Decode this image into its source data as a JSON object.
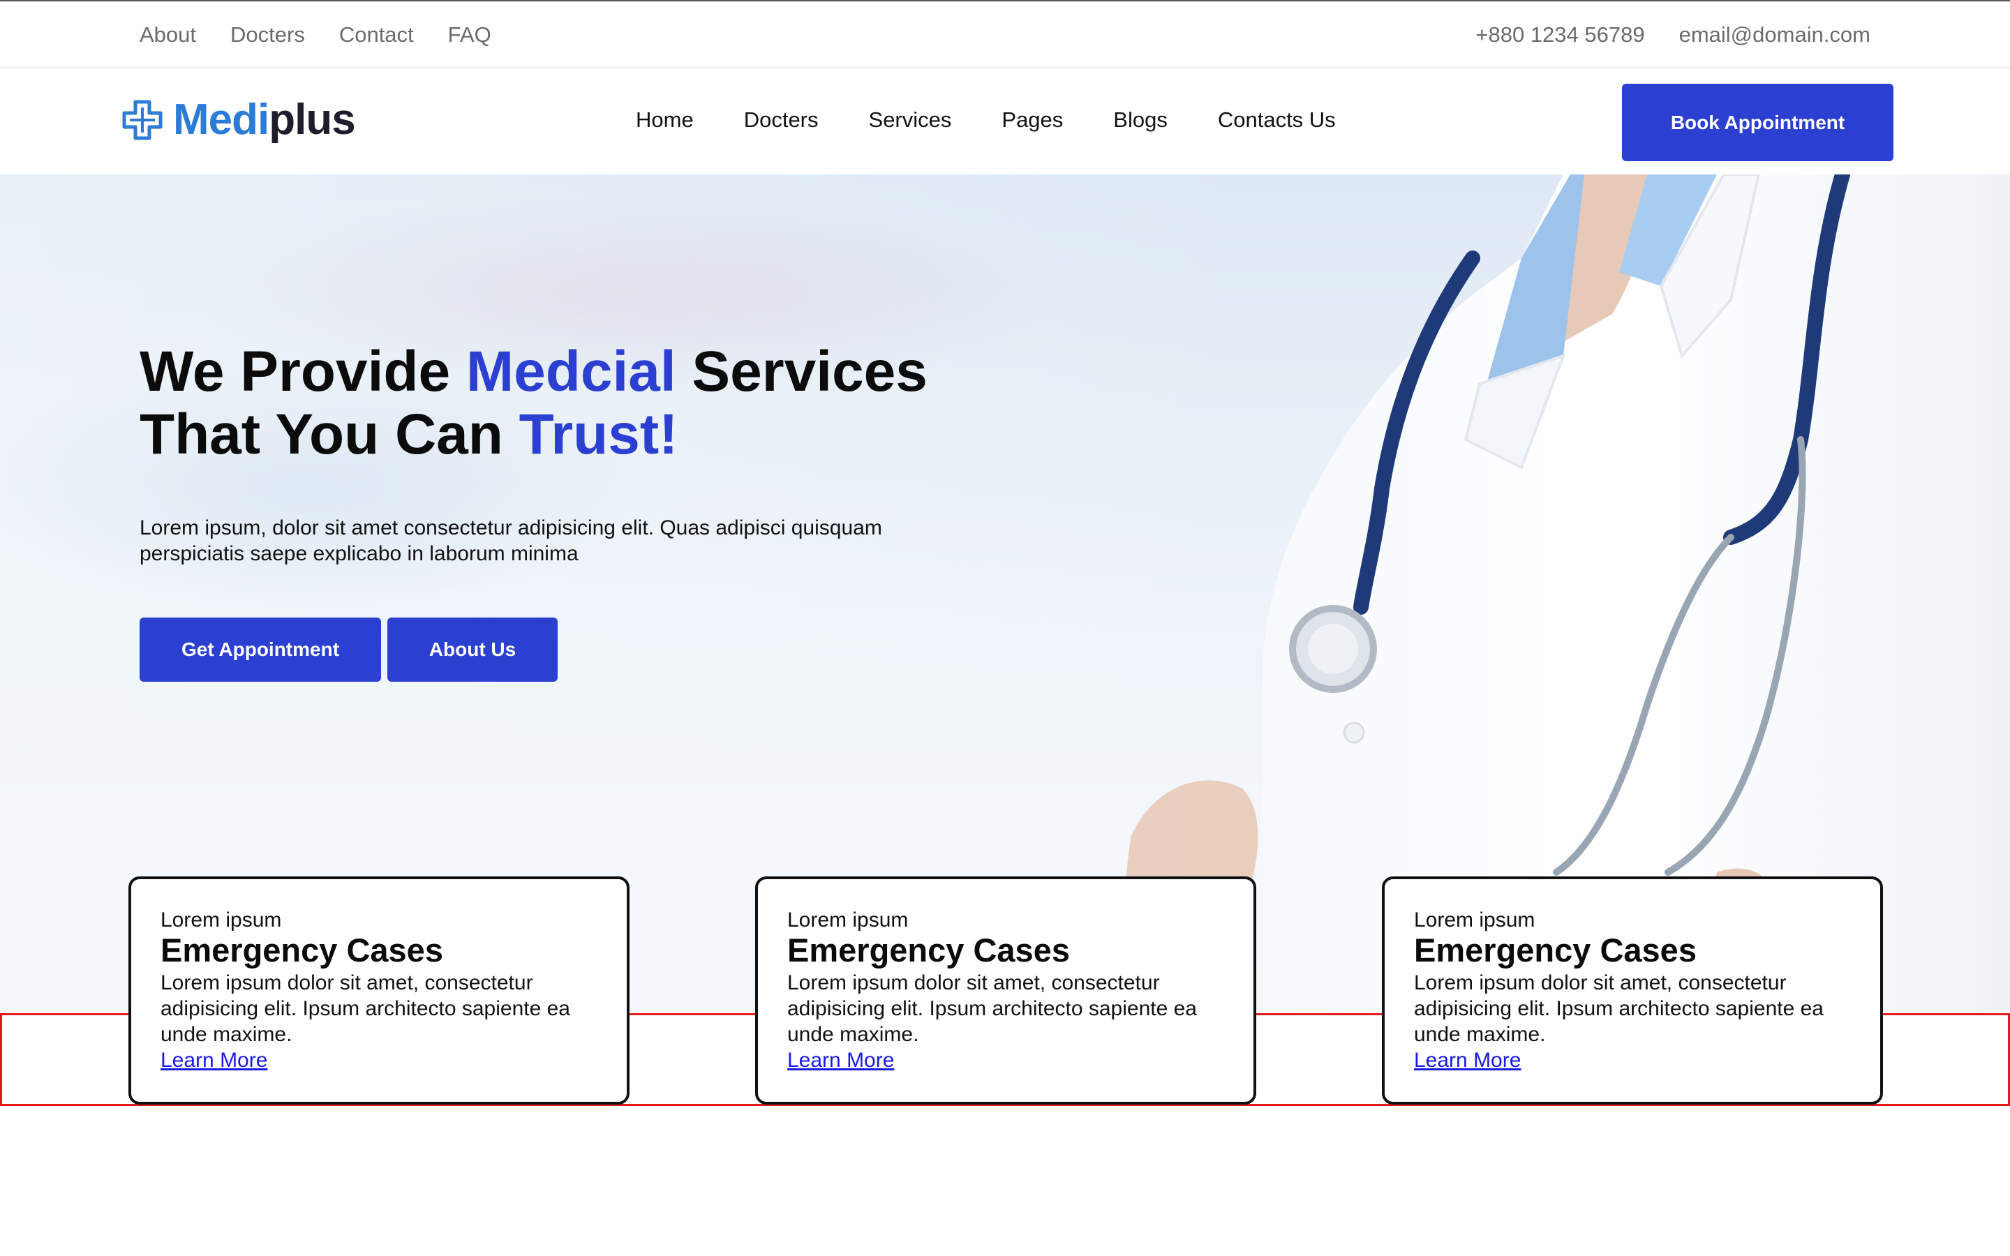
{
  "topbar": {
    "links": [
      "About",
      "Docters",
      "Contact",
      "FAQ"
    ],
    "phone": "+880 1234 56789",
    "email": "email@domain.com"
  },
  "brand": {
    "part1": "Medi",
    "part2": "plus"
  },
  "nav": {
    "items": [
      "Home",
      "Docters",
      "Services",
      "Pages",
      "Blogs",
      "Contacts Us"
    ],
    "cta": "Book Appointment"
  },
  "hero": {
    "title_1": "We Provide ",
    "title_accent_1": "Medcial",
    "title_2": " Services",
    "title_3": "That You Can ",
    "title_accent_2": "Trust!",
    "description": "Lorem ipsum, dolor sit amet consectetur adipisicing elit. Quas adipisci quisquam perspiciatis saepe explicabo in laborum minima",
    "btn_primary": "Get Appointment",
    "btn_secondary": "About Us"
  },
  "cards": [
    {
      "eyebrow": "Lorem ipsum",
      "title": "Emergency Cases",
      "desc": "Lorem ipsum dolor sit amet, consectetur adipisicing elit. Ipsum architecto sapiente ea unde maxime.",
      "link": "Learn More"
    },
    {
      "eyebrow": "Lorem ipsum",
      "title": "Emergency Cases",
      "desc": "Lorem ipsum dolor sit amet, consectetur adipisicing elit. Ipsum architecto sapiente ea unde maxime.",
      "link": "Learn More"
    },
    {
      "eyebrow": "Lorem ipsum",
      "title": "Emergency Cases",
      "desc": "Lorem ipsum dolor sit amet, consectetur adipisicing elit. Ipsum architecto sapiente ea unde maxime.",
      "link": "Learn More"
    }
  ],
  "colors": {
    "accent": "#2b3fd1",
    "logo_blue": "#2b7bd7",
    "highlight_border": "#e01d1d"
  }
}
